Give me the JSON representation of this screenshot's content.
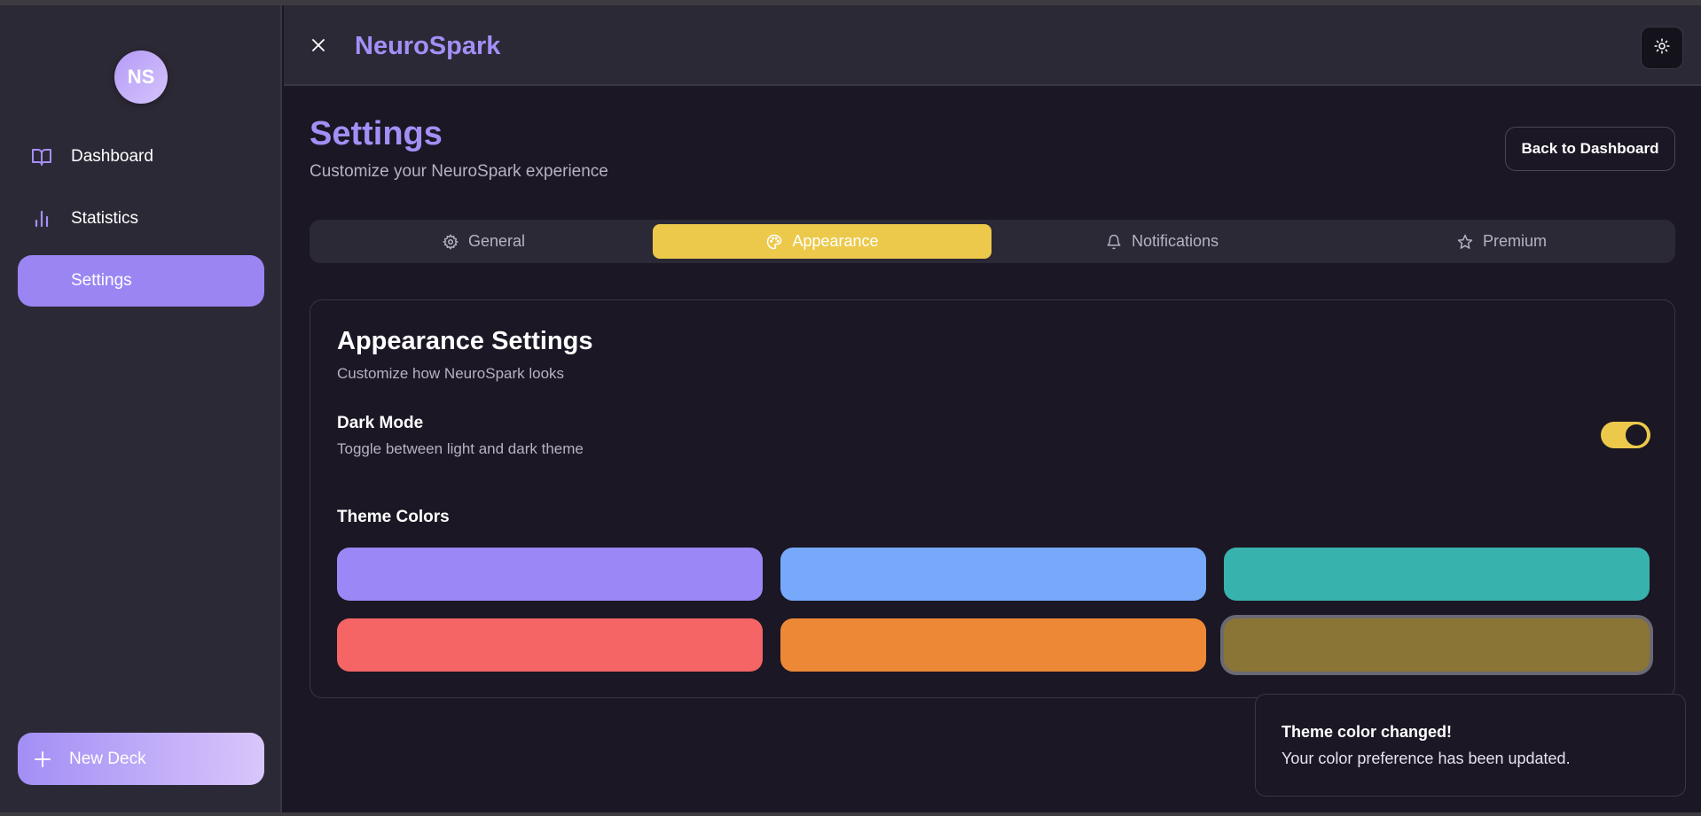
{
  "app": {
    "name": "NeuroSpark",
    "avatar_initials": "NS"
  },
  "sidebar": {
    "items": [
      {
        "label": "Dashboard",
        "icon": "book-open-icon"
      },
      {
        "label": "Statistics",
        "icon": "bar-chart-icon"
      },
      {
        "label": "Settings",
        "active": true
      }
    ],
    "new_deck_label": "New Deck"
  },
  "header": {
    "theme_button_icon": "sun-icon"
  },
  "page": {
    "title": "Settings",
    "subtitle": "Customize your NeuroSpark experience",
    "back_label": "Back to Dashboard"
  },
  "tabs": [
    {
      "label": "General",
      "icon": "gear-icon"
    },
    {
      "label": "Appearance",
      "icon": "palette-icon",
      "active": true
    },
    {
      "label": "Notifications",
      "icon": "bell-icon"
    },
    {
      "label": "Premium",
      "icon": "star-icon"
    }
  ],
  "appearance": {
    "title": "Appearance Settings",
    "subtitle": "Customize how NeuroSpark looks",
    "dark_mode_label": "Dark Mode",
    "dark_mode_desc": "Toggle between light and dark theme",
    "dark_mode_on": true,
    "theme_colors_label": "Theme Colors",
    "colors": [
      "#9b87f5",
      "#76a9fa",
      "#38b2ac",
      "#f56565",
      "#ed8936",
      "#8b7536"
    ],
    "selected_color_index": 5
  },
  "toast": {
    "title": "Theme color changed!",
    "body": "Your color preference has been updated."
  },
  "colors": {
    "accent": "#9b85f3",
    "highlight": "#ecc94b",
    "background": "#1b1724",
    "surface": "#2c2936"
  }
}
